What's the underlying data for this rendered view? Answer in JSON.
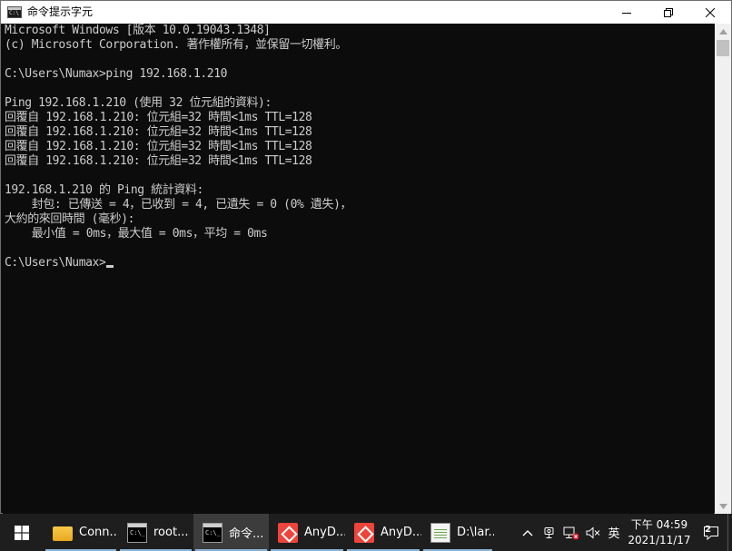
{
  "window": {
    "title": "命令提示字元"
  },
  "console": {
    "lines": [
      "Microsoft Windows [版本 10.0.19043.1348]",
      "(c) Microsoft Corporation. 著作權所有，並保留一切權利。",
      "",
      "C:\\Users\\Numax>ping 192.168.1.210",
      "",
      "Ping 192.168.1.210 (使用 32 位元組的資料):",
      "回覆自 192.168.1.210: 位元組=32 時間<1ms TTL=128",
      "回覆自 192.168.1.210: 位元組=32 時間<1ms TTL=128",
      "回覆自 192.168.1.210: 位元組=32 時間<1ms TTL=128",
      "回覆自 192.168.1.210: 位元組=32 時間<1ms TTL=128",
      "",
      "192.168.1.210 的 Ping 統計資料:",
      "    封包: 已傳送 = 4，已收到 = 4, 已遺失 = 0 (0% 遺失)，",
      "大約的來回時間 (毫秒):",
      "    最小值 = 0ms，最大值 = 0ms，平均 = 0ms",
      "",
      "C:\\Users\\Numax>"
    ]
  },
  "taskbar": {
    "items": [
      {
        "label": "Conn...",
        "icon": "folder-icon"
      },
      {
        "label": "root...",
        "icon": "cmd-icon"
      },
      {
        "label": "命令...",
        "icon": "cmd-icon"
      },
      {
        "label": "AnyD...",
        "icon": "anydesk-icon"
      },
      {
        "label": "AnyD...",
        "icon": "anydesk-icon"
      },
      {
        "label": "D:\\lar...",
        "icon": "notepad-icon"
      }
    ],
    "tray": {
      "ime": "英",
      "time": "下午 04:59",
      "date": "2021/11/17",
      "notification_count": "2"
    }
  },
  "colors": {
    "console_bg": "#0c0c0c",
    "console_text": "#cccccc",
    "taskbar_bg": "#1e1e1e",
    "active_underline": "#8ab4d8",
    "anydesk_red": "#ef443b"
  }
}
